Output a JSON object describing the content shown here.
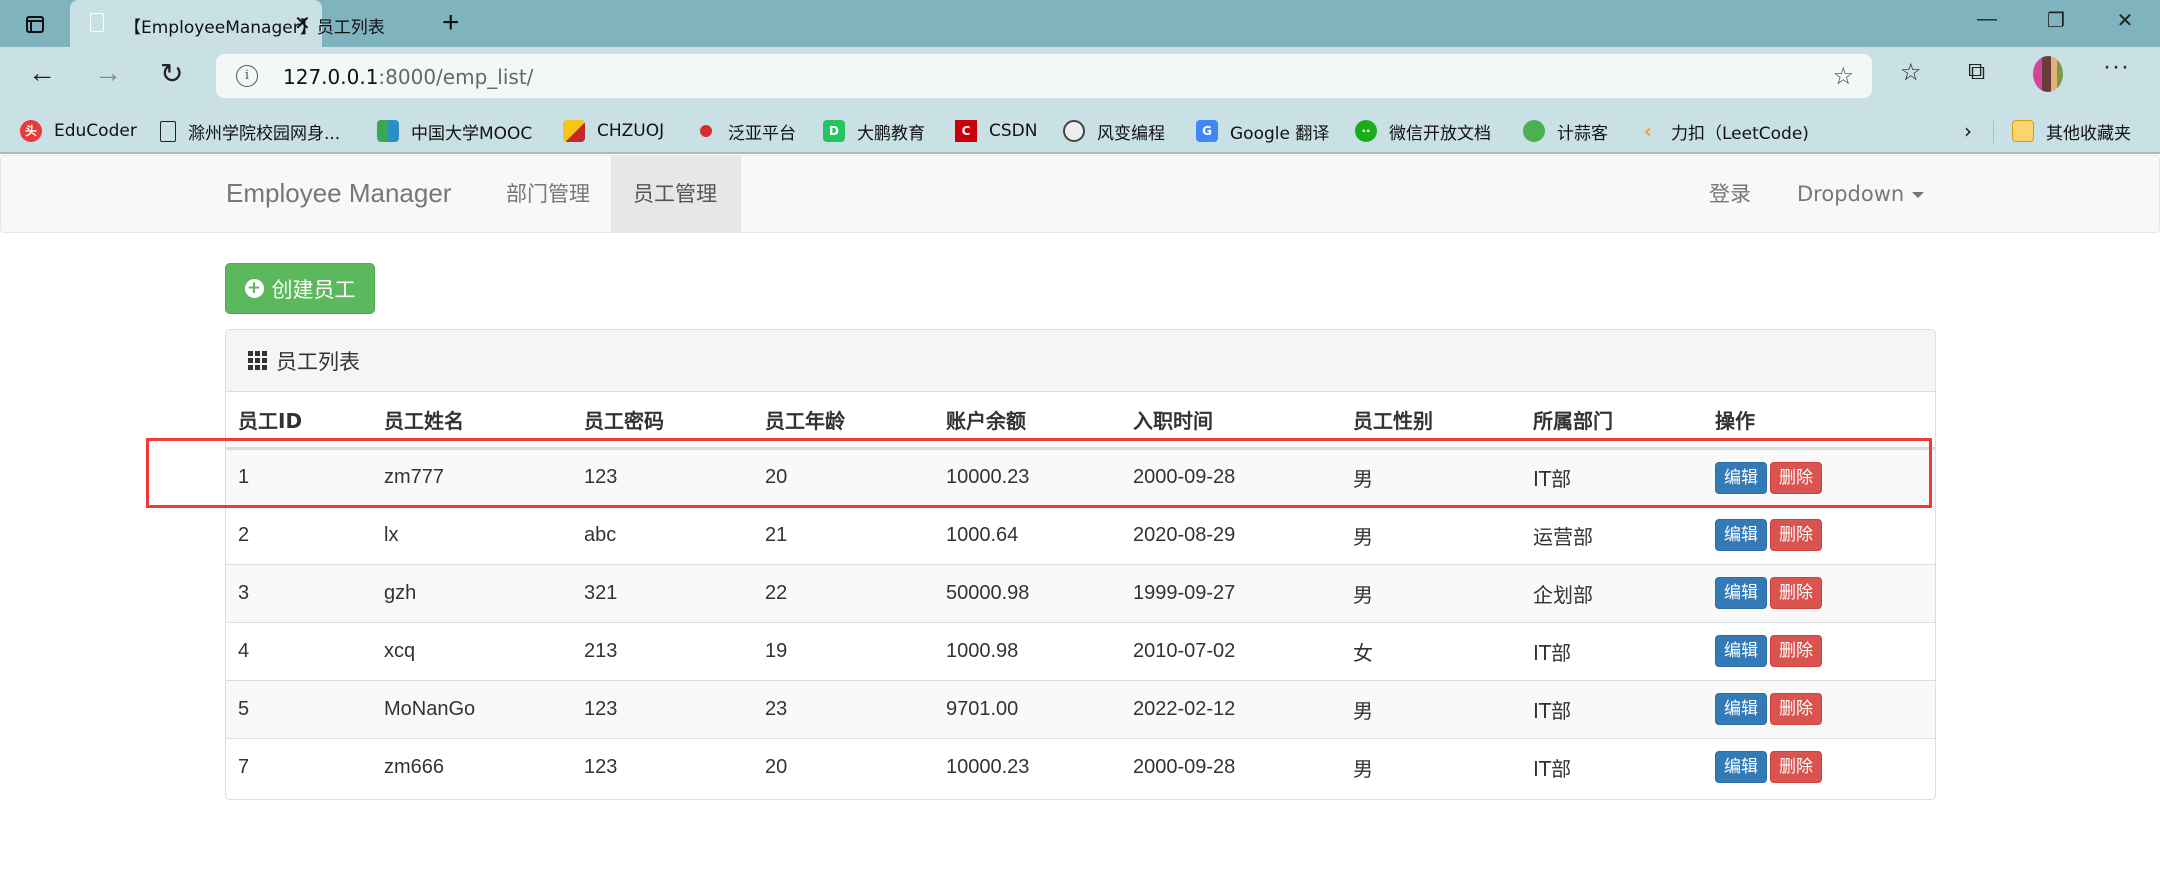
{
  "browser": {
    "tab_title": "【EmployeeManager】员工列表",
    "url_host": "127.0.0.1",
    "url_path": ":8000/emp_list/",
    "bookmarks": [
      {
        "label": "EduCoder",
        "icon": "educoder-icon",
        "color": "#e8393b"
      },
      {
        "label": "滁州学院校园网身...",
        "icon": "page-icon",
        "color": ""
      },
      {
        "label": "中国大学MOOC",
        "icon": "mooc-icon",
        "color": "#3aa757"
      },
      {
        "label": "CHZUOJ",
        "icon": "chzuoj-icon",
        "color": "#f5c518"
      },
      {
        "label": "泛亚平台",
        "icon": "fanya-icon",
        "color": "#d32f2f"
      },
      {
        "label": "大鹏教育",
        "icon": "dapeng-icon",
        "color": "#22c55e"
      },
      {
        "label": "CSDN",
        "icon": "csdn-icon",
        "color": "#c8000b"
      },
      {
        "label": "风变编程",
        "icon": "fengbian-icon",
        "color": "#555555"
      },
      {
        "label": "Google 翻译",
        "icon": "google-translate-icon",
        "color": "#4285f4"
      },
      {
        "label": "微信开放文档",
        "icon": "wechat-icon",
        "color": "#1aad19"
      },
      {
        "label": "计蒜客",
        "icon": "jisuanke-icon",
        "color": "#4caf50"
      },
      {
        "label": "力扣（LeetCode)",
        "icon": "leetcode-icon",
        "color": "#f89f1b"
      }
    ],
    "other_bookmarks": "其他收藏夹"
  },
  "navbar": {
    "brand": "Employee Manager",
    "links": [
      {
        "label": "部门管理",
        "active": false
      },
      {
        "label": "员工管理",
        "active": true
      }
    ],
    "login": "登录",
    "dropdown": "Dropdown"
  },
  "actions": {
    "create_label": "创建员工"
  },
  "panel": {
    "title": "员工列表",
    "columns": [
      "员工ID",
      "员工姓名",
      "员工密码",
      "员工年龄",
      "账户余额",
      "入职时间",
      "员工性别",
      "所属部门",
      "操作"
    ],
    "edit_label": "编辑",
    "delete_label": "删除",
    "rows": [
      {
        "id": "1",
        "name": "zm777",
        "password": "123",
        "age": "20",
        "balance": "10000.23",
        "hire_date": "2000-09-28",
        "gender": "男",
        "department": "IT部",
        "highlighted": true
      },
      {
        "id": "2",
        "name": "lx",
        "password": "abc",
        "age": "21",
        "balance": "1000.64",
        "hire_date": "2020-08-29",
        "gender": "男",
        "department": "运营部"
      },
      {
        "id": "3",
        "name": "gzh",
        "password": "321",
        "age": "22",
        "balance": "50000.98",
        "hire_date": "1999-09-27",
        "gender": "男",
        "department": "企划部"
      },
      {
        "id": "4",
        "name": "xcq",
        "password": "213",
        "age": "19",
        "balance": "1000.98",
        "hire_date": "2010-07-02",
        "gender": "女",
        "department": "IT部"
      },
      {
        "id": "5",
        "name": "MoNanGo",
        "password": "123",
        "age": "23",
        "balance": "9701.00",
        "hire_date": "2022-02-12",
        "gender": "男",
        "department": "IT部"
      },
      {
        "id": "7",
        "name": "zm666",
        "password": "123",
        "age": "20",
        "balance": "10000.23",
        "hire_date": "2000-09-28",
        "gender": "男",
        "department": "IT部"
      }
    ]
  },
  "colors": {
    "highlight": "#f03a3a",
    "success": "#5cb85c",
    "primary": "#337ab7",
    "danger": "#d9534f"
  }
}
